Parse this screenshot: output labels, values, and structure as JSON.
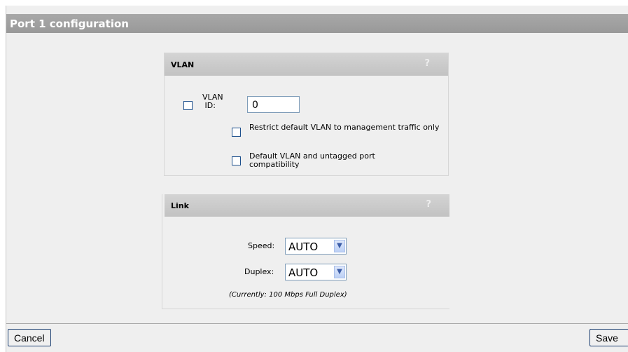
{
  "page": {
    "title": "Port 1 configuration"
  },
  "vlan": {
    "header": "VLAN",
    "help": "?",
    "id_label": "VLAN ID:",
    "id_value": "0",
    "id_checked": false,
    "restrict_label": "Restrict default VLAN to management traffic only",
    "restrict_checked": false,
    "compat_label": "Default VLAN and untagged port compatibility",
    "compat_checked": false
  },
  "link": {
    "header": "Link",
    "help": "?",
    "speed_label": "Speed:",
    "speed_value": "AUTO",
    "duplex_label": "Duplex:",
    "duplex_value": "AUTO",
    "status": "(Currently: 100 Mbps Full Duplex)"
  },
  "footer": {
    "cancel": "Cancel",
    "save": "Save"
  },
  "icons": {
    "dropdown": "chevron-down-icon"
  }
}
